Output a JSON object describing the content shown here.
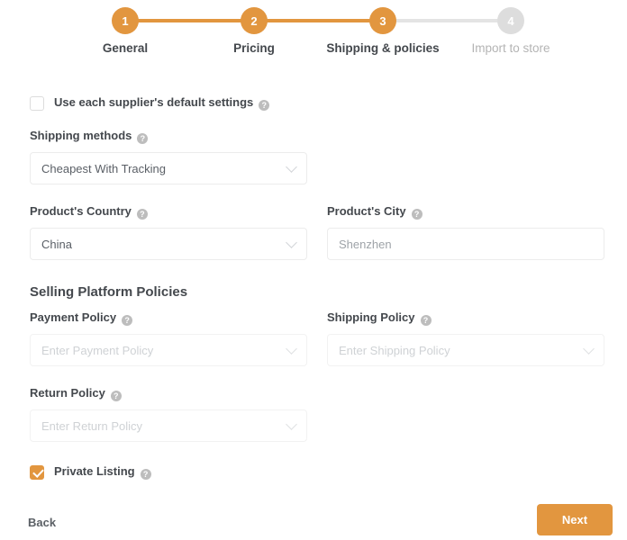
{
  "stepper": {
    "steps": [
      {
        "number": "1",
        "label": "General",
        "state": "complete"
      },
      {
        "number": "2",
        "label": "Pricing",
        "state": "complete"
      },
      {
        "number": "3",
        "label": "Shipping & policies",
        "state": "current"
      },
      {
        "number": "4",
        "label": "Import to store",
        "state": "upcoming"
      }
    ],
    "active_color": "#e2963f",
    "inactive_color": "#dddddd"
  },
  "form": {
    "supplier_defaults": {
      "label": "Use each supplier's default settings",
      "checked": false,
      "help": "?"
    },
    "shipping_methods": {
      "label": "Shipping methods",
      "value": "Cheapest With Tracking",
      "help": "?"
    },
    "product_country": {
      "label": "Product's Country",
      "value": "China",
      "help": "?"
    },
    "product_city": {
      "label": "Product's City",
      "value": "Shenzhen",
      "placeholder": "Shenzhen",
      "help": "?"
    },
    "policies_heading": "Selling Platform Policies",
    "payment_policy": {
      "label": "Payment Policy",
      "value": "Enter Payment Policy",
      "placeholder": "Enter Payment Policy",
      "help": "?",
      "disabled": true
    },
    "shipping_policy": {
      "label": "Shipping Policy",
      "value": "Enter Shipping Policy",
      "placeholder": "Enter Shipping Policy",
      "help": "?",
      "disabled": true
    },
    "return_policy": {
      "label": "Return Policy",
      "value": "Enter Return Policy",
      "placeholder": "Enter Return Policy",
      "help": "?",
      "disabled": true
    },
    "private_listing": {
      "label": "Private Listing",
      "checked": true,
      "help": "?"
    }
  },
  "footer": {
    "back_label": "Back",
    "next_label": "Next",
    "next_color": "#e2963f"
  }
}
